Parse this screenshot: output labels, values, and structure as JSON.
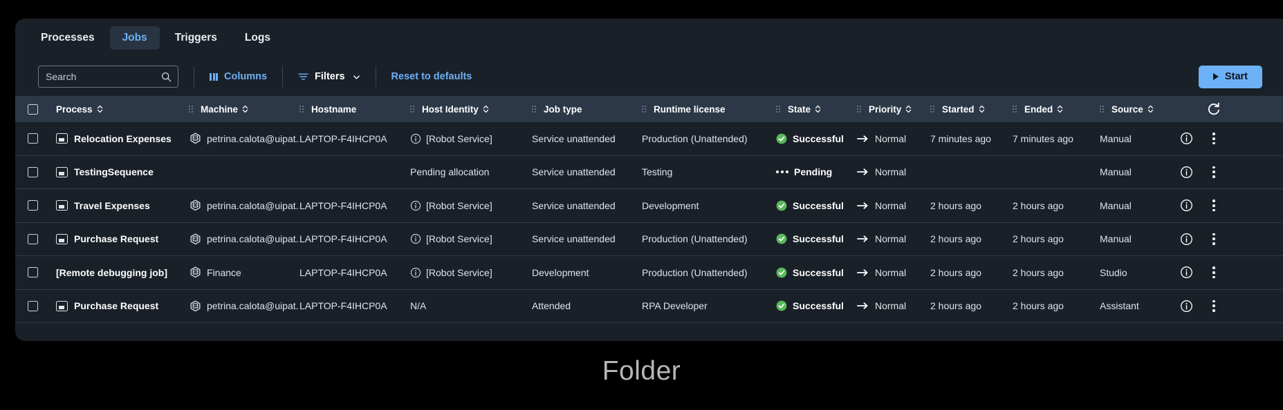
{
  "tabs": [
    {
      "label": "Processes",
      "active": false
    },
    {
      "label": "Jobs",
      "active": true
    },
    {
      "label": "Triggers",
      "active": false
    },
    {
      "label": "Logs",
      "active": false
    }
  ],
  "toolbar": {
    "search_placeholder": "Search",
    "search_value": "",
    "search_icon": "search-icon",
    "columns_label": "Columns",
    "columns_icon": "columns-icon",
    "filters_label": "Filters",
    "filters_icon": "filter-icon",
    "filters_chevron": "chevron-down-icon",
    "reset_label": "Reset to defaults",
    "start_label": "Start",
    "start_icon": "play-icon"
  },
  "table": {
    "refresh_icon": "refresh-icon",
    "columns": [
      {
        "label": "Process",
        "sortable": true
      },
      {
        "label": "Machine",
        "sortable": true
      },
      {
        "label": "Hostname",
        "sortable": false
      },
      {
        "label": "Host Identity",
        "sortable": true
      },
      {
        "label": "Job type",
        "sortable": false
      },
      {
        "label": "Runtime license",
        "sortable": false
      },
      {
        "label": "State",
        "sortable": true
      },
      {
        "label": "Priority",
        "sortable": true
      },
      {
        "label": "Started",
        "sortable": true
      },
      {
        "label": "Ended",
        "sortable": true
      },
      {
        "label": "Source",
        "sortable": true
      }
    ],
    "rows": [
      {
        "process": "Relocation Expenses",
        "has_process_icon": true,
        "machine": "petrina.calota@uipat...",
        "has_machine_icon": true,
        "hostname": "LAPTOP-F4IHCP0A",
        "host_identity": "[Robot Service]",
        "has_identity_icon": true,
        "job_type": "Service unattended",
        "runtime_license": "Production (Unattended)",
        "state": "Successful",
        "state_kind": "success",
        "priority": "Normal",
        "started": "7 minutes ago",
        "ended": "7 minutes ago",
        "source": "Manual"
      },
      {
        "process": "TestingSequence",
        "has_process_icon": true,
        "machine": "",
        "has_machine_icon": false,
        "hostname": "",
        "host_identity": "Pending allocation",
        "has_identity_icon": false,
        "job_type": "Service unattended",
        "runtime_license": "Testing",
        "state": "Pending",
        "state_kind": "pending",
        "priority": "Normal",
        "started": "",
        "ended": "",
        "source": "Manual"
      },
      {
        "process": "Travel Expenses",
        "has_process_icon": true,
        "machine": "petrina.calota@uipat...",
        "has_machine_icon": true,
        "hostname": "LAPTOP-F4IHCP0A",
        "host_identity": "[Robot Service]",
        "has_identity_icon": true,
        "job_type": "Service unattended",
        "runtime_license": "Development",
        "state": "Successful",
        "state_kind": "success",
        "priority": "Normal",
        "started": "2 hours ago",
        "ended": "2 hours ago",
        "source": "Manual"
      },
      {
        "process": "Purchase Request",
        "has_process_icon": true,
        "machine": "petrina.calota@uipat...",
        "has_machine_icon": true,
        "hostname": "LAPTOP-F4IHCP0A",
        "host_identity": "[Robot Service]",
        "has_identity_icon": true,
        "job_type": "Service unattended",
        "runtime_license": "Production (Unattended)",
        "state": "Successful",
        "state_kind": "success",
        "priority": "Normal",
        "started": "2 hours ago",
        "ended": "2 hours ago",
        "source": "Manual"
      },
      {
        "process": "[Remote debugging job]",
        "has_process_icon": false,
        "machine": "Finance",
        "has_machine_icon": true,
        "hostname": "LAPTOP-F4IHCP0A",
        "host_identity": "[Robot Service]",
        "has_identity_icon": true,
        "job_type": "Development",
        "runtime_license": "Production (Unattended)",
        "state": "Successful",
        "state_kind": "success",
        "priority": "Normal",
        "started": "2 hours ago",
        "ended": "2 hours ago",
        "source": "Studio"
      },
      {
        "process": "Purchase Request",
        "has_process_icon": true,
        "machine": "petrina.calota@uipat...",
        "has_machine_icon": true,
        "hostname": "LAPTOP-F4IHCP0A",
        "host_identity": "N/A",
        "has_identity_icon": false,
        "job_type": "Attended",
        "runtime_license": "RPA Developer",
        "state": "Successful",
        "state_kind": "success",
        "priority": "Normal",
        "started": "2 hours ago",
        "ended": "2 hours ago",
        "source": "Assistant"
      }
    ],
    "row_info_icon": "info-icon",
    "row_menu_icon": "more-vertical-icon"
  },
  "caption": "Folder",
  "colors": {
    "accent_blue": "#6cb0f5",
    "success_green": "#5cb85c",
    "panel_bg": "#1a2028",
    "header_bg": "#2c3847",
    "page_bg": "#000000"
  }
}
